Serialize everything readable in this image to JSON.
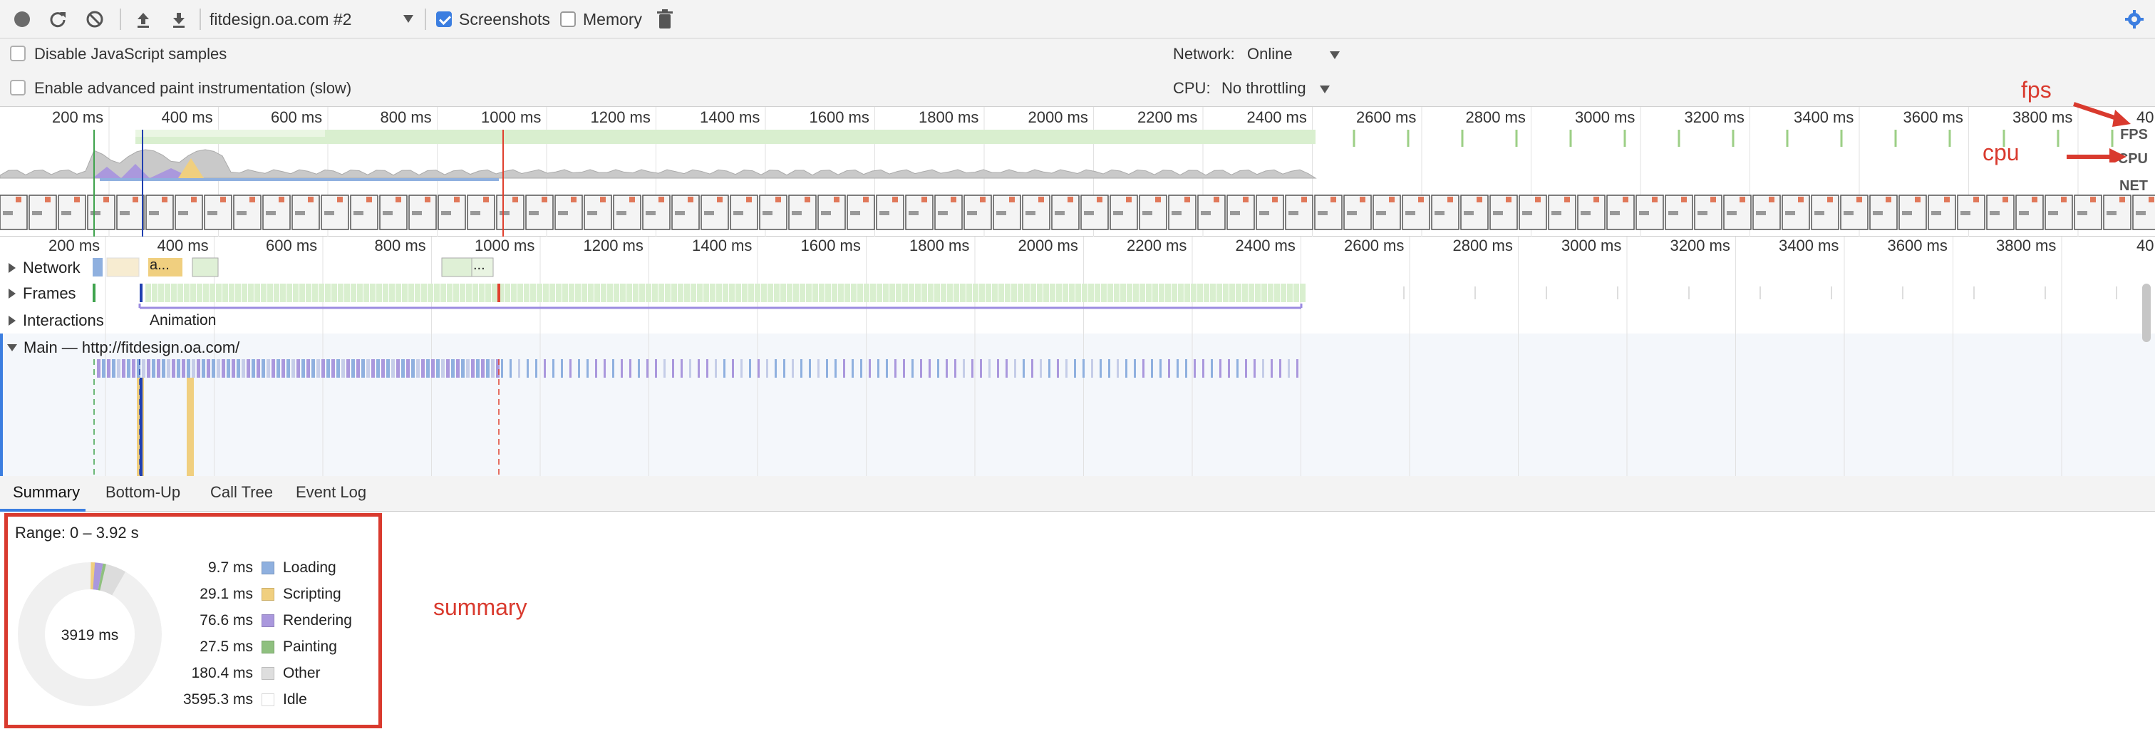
{
  "toolbar": {
    "profile_select": "fitdesign.oa.com #2",
    "screenshots_label": "Screenshots",
    "screenshots_checked": true,
    "memory_label": "Memory",
    "memory_checked": false
  },
  "settings": {
    "disable_js_samples_label": "Disable JavaScript samples",
    "advanced_paint_label": "Enable advanced paint instrumentation (slow)",
    "network_label": "Network:",
    "network_value": "Online",
    "cpu_label": "CPU:",
    "cpu_value": "No throttling"
  },
  "overview": {
    "ruler_ticks": [
      "200 ms",
      "400 ms",
      "600 ms",
      "800 ms",
      "1000 ms",
      "1200 ms",
      "1400 ms",
      "1600 ms",
      "1800 ms",
      "2000 ms",
      "2200 ms",
      "2400 ms",
      "2600 ms",
      "2800 ms",
      "3000 ms",
      "3200 ms",
      "3400 ms",
      "3600 ms",
      "3800 ms",
      "40"
    ],
    "track_labels": {
      "fps": "FPS",
      "cpu": "CPU",
      "net": "NET"
    }
  },
  "flame": {
    "ruler_ticks": [
      "200 ms",
      "400 ms",
      "600 ms",
      "800 ms",
      "1000 ms",
      "1200 ms",
      "1400 ms",
      "1600 ms",
      "1800 ms",
      "2000 ms",
      "2200 ms",
      "2400 ms",
      "2600 ms",
      "2800 ms",
      "3000 ms",
      "3200 ms",
      "3400 ms",
      "3600 ms",
      "3800 ms",
      "40"
    ],
    "rows": {
      "network": "Network",
      "frames": "Frames",
      "interactions": "Interactions",
      "main": "Main — http://fitdesign.oa.com/"
    },
    "network_item_label": "a...",
    "network_item_label2": "...",
    "animation_label": "Animation"
  },
  "tabs": [
    "Summary",
    "Bottom-Up",
    "Call Tree",
    "Event Log"
  ],
  "summary": {
    "range": "Range: 0 – 3.92 s",
    "total": "3919 ms",
    "items": [
      {
        "value": "9.7 ms",
        "label": "Loading",
        "color": "#8fb0df"
      },
      {
        "value": "29.1 ms",
        "label": "Scripting",
        "color": "#f0cf7f"
      },
      {
        "value": "76.6 ms",
        "label": "Rendering",
        "color": "#aa98dd"
      },
      {
        "value": "27.5 ms",
        "label": "Painting",
        "color": "#8fc07f"
      },
      {
        "value": "180.4 ms",
        "label": "Other",
        "color": "#dedede"
      },
      {
        "value": "3595.3 ms",
        "label": "Idle",
        "color": "#ffffff"
      }
    ]
  },
  "annotations": {
    "fps": "fps",
    "cpu": "cpu",
    "summary": "summary"
  },
  "colors": {
    "accent_red": "#d93a2e",
    "checkbox_blue": "#3c7ee0",
    "fps_green": "#bfe3b1"
  }
}
